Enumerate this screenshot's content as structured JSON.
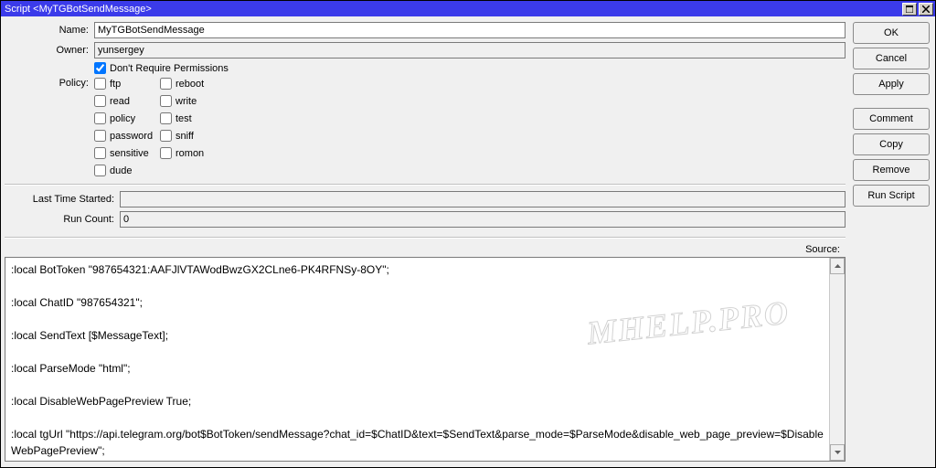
{
  "title": "Script <MyTGBotSendMessage>",
  "buttons": {
    "ok": "OK",
    "cancel": "Cancel",
    "apply": "Apply",
    "comment": "Comment",
    "copy": "Copy",
    "remove": "Remove",
    "run": "Run Script"
  },
  "labels": {
    "name": "Name:",
    "owner": "Owner:",
    "policy": "Policy:",
    "lastStart": "Last Time Started:",
    "runCount": "Run Count:",
    "source": "Source:"
  },
  "fields": {
    "name": "MyTGBotSendMessage",
    "owner": "yunsergey",
    "lastStart": "",
    "runCount": "0"
  },
  "dontRequire": {
    "label": "Don't Require Permissions",
    "checked": true
  },
  "policies": {
    "col1": [
      {
        "k": "ftp",
        "l": "ftp"
      },
      {
        "k": "read",
        "l": "read"
      },
      {
        "k": "policy",
        "l": "policy"
      },
      {
        "k": "password",
        "l": "password"
      },
      {
        "k": "sensitive",
        "l": "sensitive"
      },
      {
        "k": "dude",
        "l": "dude"
      }
    ],
    "col2": [
      {
        "k": "reboot",
        "l": "reboot"
      },
      {
        "k": "write",
        "l": "write"
      },
      {
        "k": "test",
        "l": "test"
      },
      {
        "k": "sniff",
        "l": "sniff"
      },
      {
        "k": "romon",
        "l": "romon"
      }
    ]
  },
  "source": ":local BotToken \"987654321:AAFJlVTAWodBwzGX2CLne6-PK4RFNSy-8OY\";\n\n:local ChatID \"987654321\";\n\n:local SendText [$MessageText];\n\n:local ParseMode \"html\";\n\n:local DisableWebPagePreview True;\n\n:local tgUrl \"https://api.telegram.org/bot$BotToken/sendMessage?chat_id=$ChatID&text=$SendText&parse_mode=$ParseMode&disable_web_page_preview=$DisableWebPagePreview\";",
  "watermark": "MHELP.PRO"
}
